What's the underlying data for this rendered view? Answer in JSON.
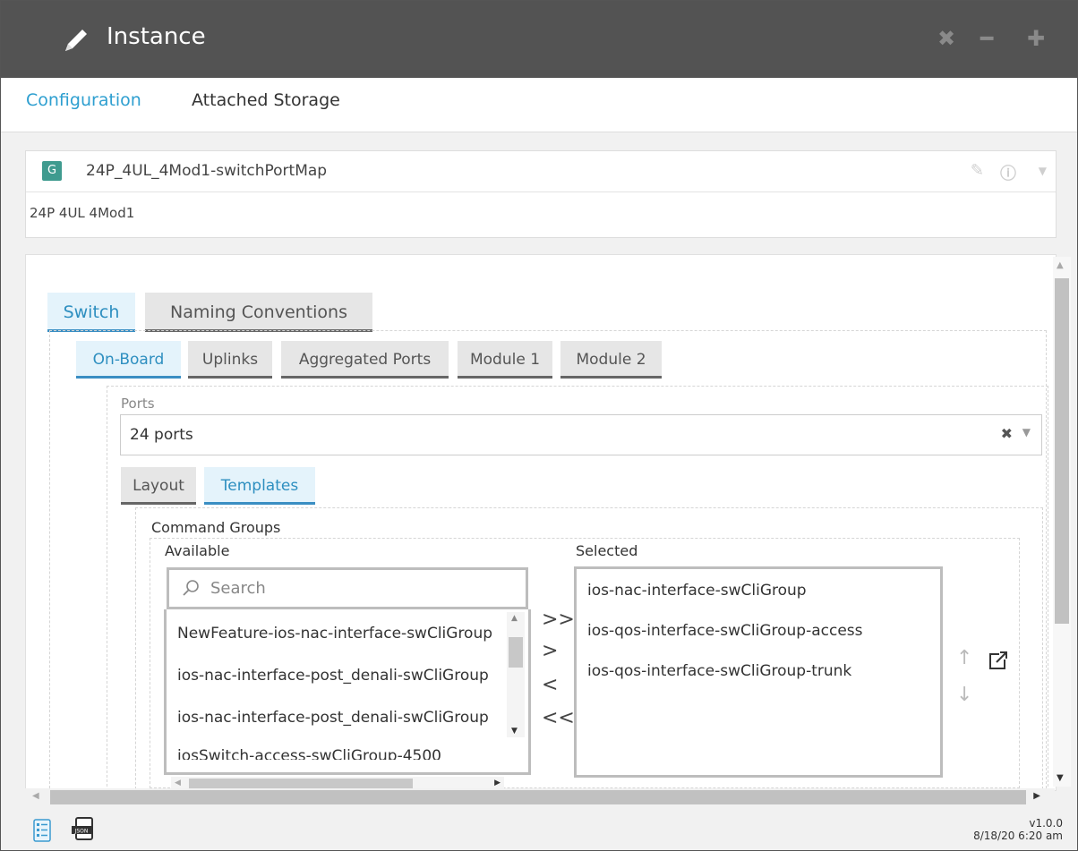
{
  "window": {
    "title": "Instance",
    "controls": [
      "close",
      "minimize",
      "maximize"
    ]
  },
  "tabs": {
    "configuration": "Configuration",
    "attached_storage": "Attached Storage"
  },
  "header": {
    "badge": "G",
    "name": "24P_4UL_4Mod1-switchPortMap",
    "description": "24P 4UL 4Mod1"
  },
  "switch_tabs": [
    "Switch",
    "Naming Conventions"
  ],
  "port_tabs": [
    "On-Board",
    "Uplinks",
    "Aggregated Ports",
    "Module 1",
    "Module 2"
  ],
  "ports": {
    "label": "Ports",
    "value": "24 ports"
  },
  "sub_tabs": [
    "Layout",
    "Templates"
  ],
  "command_groups": {
    "label": "Command Groups",
    "available_label": "Available",
    "selected_label": "Selected",
    "search_placeholder": "Search",
    "available": [
      "NewFeature-ios-nac-interface-swCliGroup",
      "ios-nac-interface-post_denali-swCliGroup",
      "ios-nac-interface-post_denali-swCliGroup",
      "iosSwitch-access-swCliGroup-4500"
    ],
    "selected": [
      "ios-nac-interface-swCliGroup",
      "ios-qos-interface-swCliGroup-access",
      "ios-qos-interface-swCliGroup-trunk"
    ],
    "move_buttons": [
      ">>",
      ">",
      "<",
      "<<"
    ]
  },
  "footer": {
    "version": "v1.0.0",
    "timestamp": "8/18/20 6:20 am"
  },
  "colors": {
    "titlebar": "#535353",
    "accent": "#2e9fd0",
    "badge": "#3f9b8f"
  }
}
